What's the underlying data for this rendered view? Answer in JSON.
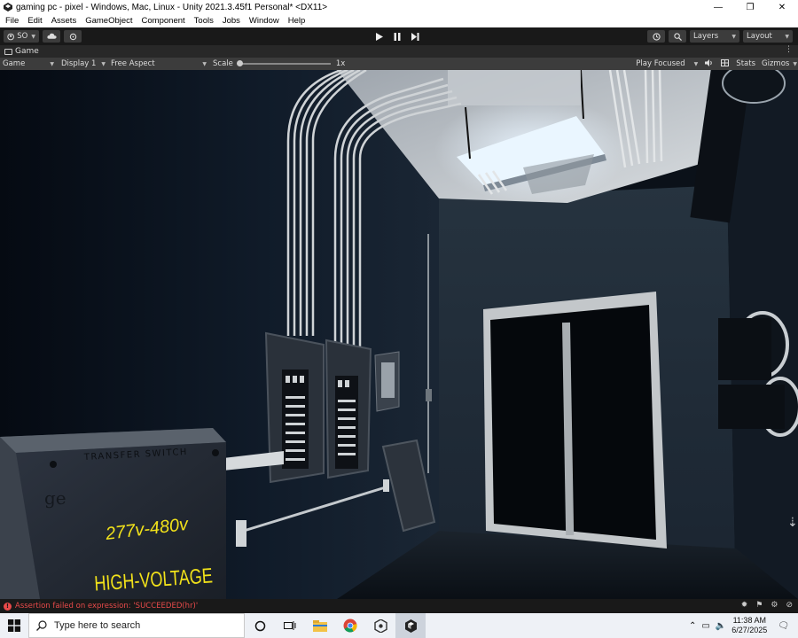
{
  "window": {
    "title": "gaming pc - pixel - Windows, Mac, Linux - Unity 2021.3.45f1 Personal* <DX11>",
    "controls": {
      "minimize": "—",
      "restore": "❐",
      "close": "✕"
    }
  },
  "menu": [
    "File",
    "Edit",
    "Assets",
    "GameObject",
    "Component",
    "Tools",
    "Jobs",
    "Window",
    "Help"
  ],
  "toolbar": {
    "account_label": "SO",
    "layers_label": "Layers",
    "layout_label": "Layout",
    "play_icons": [
      "play-icon",
      "pause-icon",
      "step-icon"
    ]
  },
  "tab": {
    "label": "Game"
  },
  "game_controls": {
    "mode": "Game",
    "display": "Display 1",
    "aspect": "Free Aspect",
    "scale_label": "Scale",
    "scale_value": "1x",
    "play_focused": "Play Focused",
    "stats": "Stats",
    "gizmos": "Gizmos"
  },
  "scene": {
    "panel_header": "TRANSFER SWITCH",
    "panel_warning": "HIGH-VOLTAGE",
    "panel_voltage": "277v-480v",
    "panel_logo": "ge"
  },
  "status": {
    "message": "Assertion failed on expression: 'SUCCEEDED(hr)'",
    "color": "#e84a4a"
  },
  "taskbar": {
    "search_placeholder": "Type here to search",
    "time": "11:38 AM",
    "date": "6/27/2025",
    "apps": [
      "cortana-icon",
      "task-view-icon",
      "file-explorer-icon",
      "chrome-icon",
      "unity-hub-icon",
      "unity-icon"
    ]
  }
}
